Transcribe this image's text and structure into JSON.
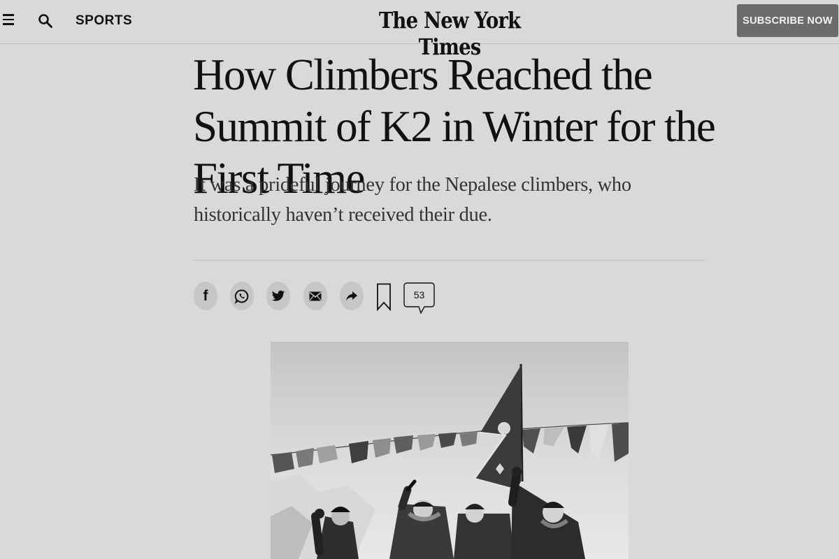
{
  "header": {
    "section_label": "SPORTS",
    "logo_text": "The New York Times",
    "subscribe_label": "SUBSCRIBE NOW",
    "icons": [
      "menu-icon",
      "search-icon"
    ]
  },
  "article": {
    "headline": "How Climbers Reached the Summit of K2 in Winter for the First Time",
    "summary": "It was a prideful journey for the Nepalese climbers, who historically haven’t received their due.",
    "comment_count": "53"
  },
  "share": {
    "icons": [
      "facebook-icon",
      "whatsapp-icon",
      "twitter-icon",
      "email-icon",
      "share-icon",
      "bookmark-icon",
      "comment-icon"
    ]
  },
  "photo": {
    "description_icons": [
      "prayer-flags",
      "nepal-flag",
      "climbers"
    ]
  },
  "colors": {
    "background": "#d9d9d9",
    "subscribe_bg": "#6b6b6b",
    "share_button_bg": "#c6c6c6"
  }
}
